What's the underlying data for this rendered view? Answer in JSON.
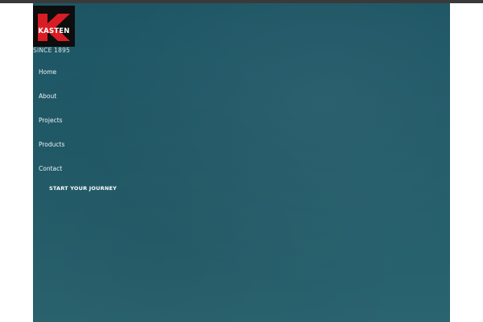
{
  "brand": {
    "logo_letter": "K",
    "logo_word": "KASTEN",
    "since": "SINCE 1895",
    "logo_colors": {
      "background": "#0d0d0d",
      "mark": "#d91d25",
      "text": "#ffffff"
    }
  },
  "nav": {
    "items": [
      {
        "label": "Home"
      },
      {
        "label": "About"
      },
      {
        "label": "Projects"
      },
      {
        "label": "Products"
      },
      {
        "label": "Contact"
      }
    ]
  },
  "cta": {
    "label": "START YOUR JOURNEY"
  },
  "colors": {
    "hero_background": "#215a68",
    "top_bar": "#3a3a3a"
  }
}
